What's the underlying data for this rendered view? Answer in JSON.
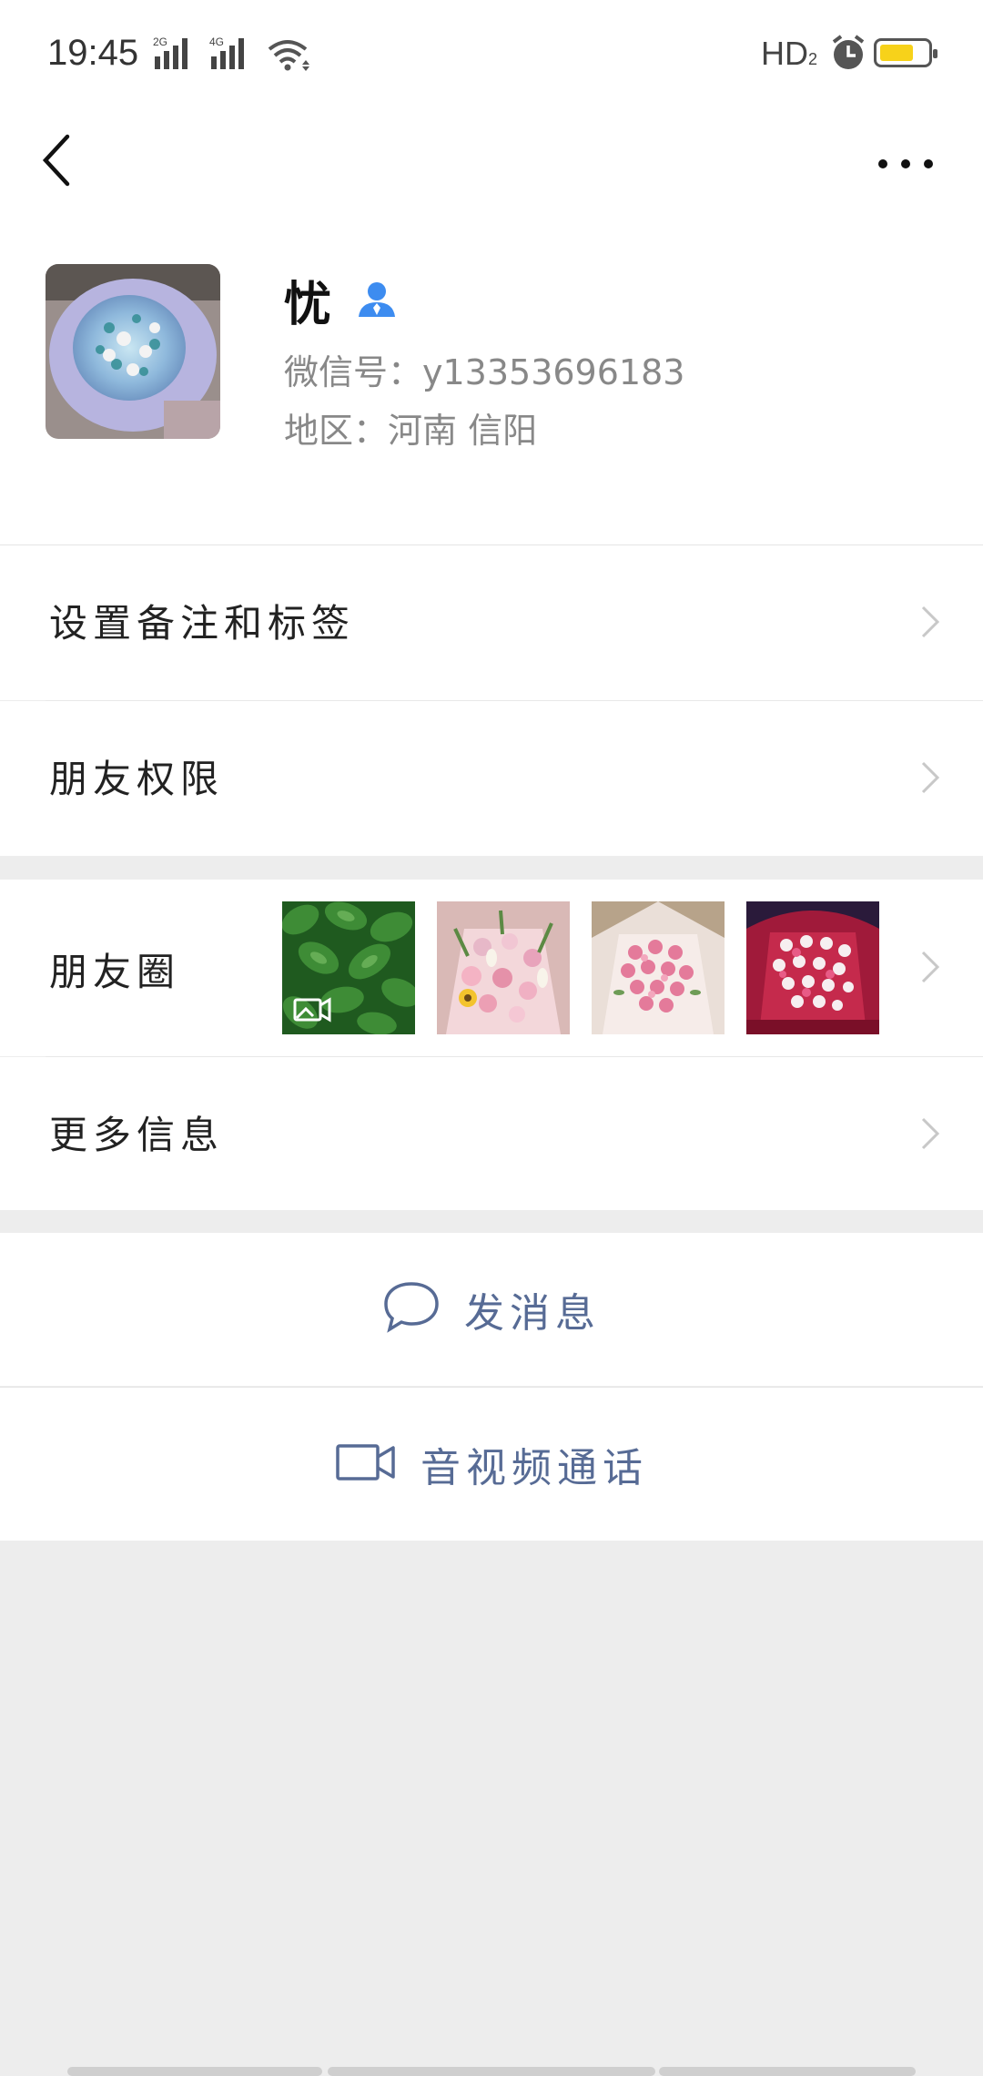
{
  "status_bar": {
    "time": "19:45",
    "network_1": "2G",
    "network_2": "4G",
    "hd_label": "HD",
    "hd_sub": "2"
  },
  "profile": {
    "name": "忧",
    "wechat_id": "微信号：y13353696183",
    "region": "地区：河南  信阳"
  },
  "menu": {
    "set_remark": "设置备注和标签",
    "friend_permissions": "朋友权限",
    "moments": "朋友圈",
    "more_info": "更多信息"
  },
  "actions": {
    "send_message": "发消息",
    "video_call": "音视频通话"
  },
  "colors": {
    "link_blue": "#576b95",
    "gender_icon": "#3d8cf0",
    "battery_fill": "#f7d21a",
    "page_bg": "#ededed"
  }
}
